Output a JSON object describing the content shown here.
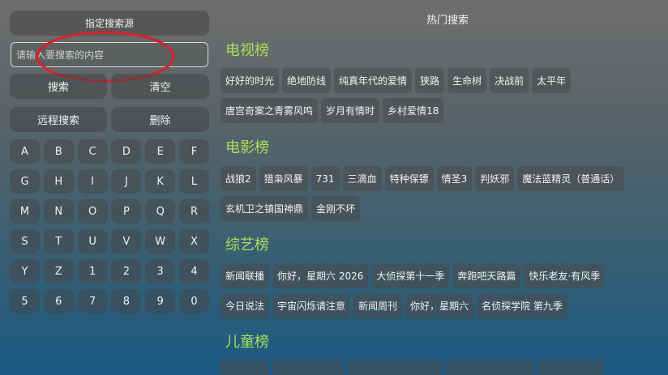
{
  "left_panel": {
    "source_button": "指定搜索源",
    "search_placeholder": "请输入要搜索的内容",
    "search_button": "搜索",
    "clear_button": "清空",
    "remote_search_button": "远程搜索",
    "delete_button": "删除",
    "keys": [
      "A",
      "B",
      "C",
      "D",
      "E",
      "F",
      "G",
      "H",
      "I",
      "J",
      "K",
      "L",
      "M",
      "N",
      "O",
      "P",
      "Q",
      "R",
      "S",
      "T",
      "U",
      "V",
      "W",
      "X",
      "Y",
      "Z",
      "1",
      "2",
      "3",
      "4",
      "5",
      "6",
      "7",
      "8",
      "9",
      "0"
    ]
  },
  "hot_search": {
    "title": "热门搜索",
    "tv": {
      "title": "电视榜",
      "row1": [
        "好好的时光",
        "绝地防线",
        "纯真年代的爱情",
        "狭路",
        "生命树",
        "决战前",
        "太平年"
      ],
      "row2": [
        "唐宫奇案之青雾风鸣",
        "岁月有情时",
        "乡村爱情18"
      ]
    },
    "movie": {
      "title": "电影榜",
      "row1": [
        "战狼2",
        "猎枭风暴",
        "731",
        "三滴血",
        "特种保镖",
        "情圣3",
        "判妖邪",
        "魔法蓝精灵（普通话）"
      ],
      "row2": [
        "玄机卫之镇国神鼎",
        "金刚不坏"
      ]
    },
    "variety": {
      "title": "综艺榜",
      "row1": [
        "新闻联播",
        "你好，星期六 2026",
        "大侦探第十一季",
        "奔跑吧天路篇",
        "快乐老友·有风季"
      ],
      "row2": [
        "今日说法",
        "宇宙闪烁请注意",
        "新闻周刊",
        "你好，星期六",
        "名侦探学院 第九季"
      ]
    },
    "kids": {
      "title": "儿童榜"
    }
  },
  "colors": {
    "section_title": "#a4e05a",
    "annotation": "#d8202a"
  }
}
